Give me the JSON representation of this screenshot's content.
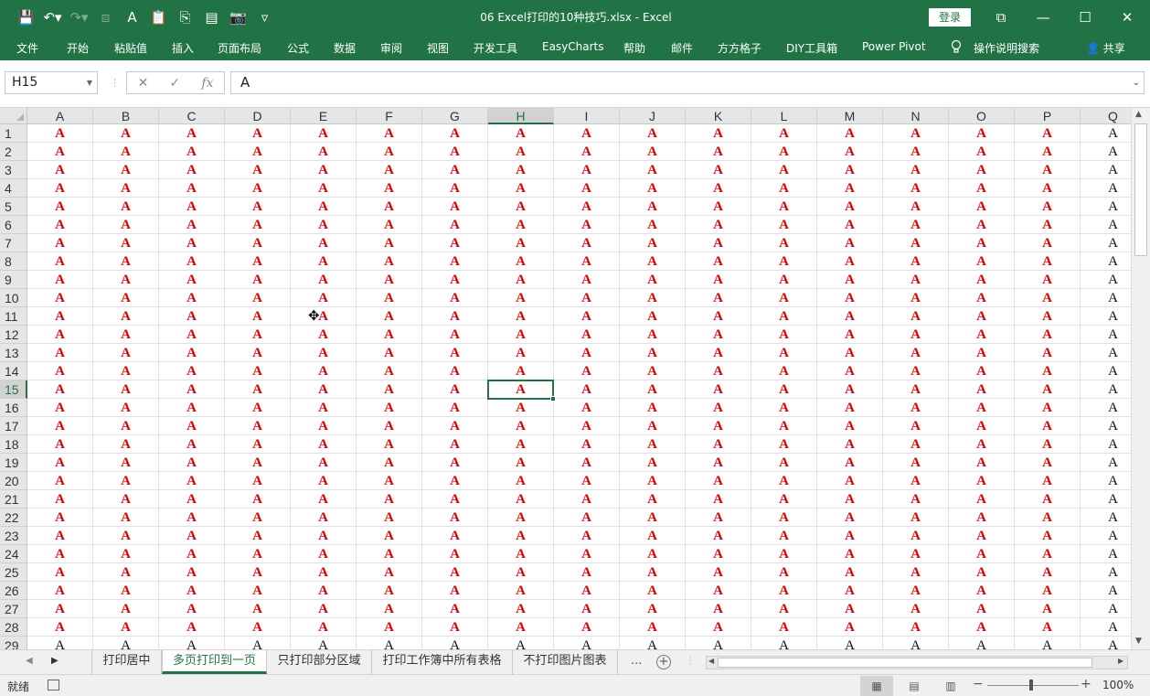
{
  "window": {
    "title": "06 Excel打印的10种技巧.xlsx  -  Excel",
    "login_label": "登录",
    "controls": {
      "restore_ribbon": "⧉",
      "minimize": "—",
      "maximize": "☐",
      "close": "✕"
    }
  },
  "qat": [
    {
      "name": "save-icon",
      "glyph": "💾"
    },
    {
      "name": "undo-icon",
      "glyph": "↶▾"
    },
    {
      "name": "redo-icon",
      "glyph": "↷▾"
    },
    {
      "name": "format-painter-icon",
      "glyph": "⧈"
    },
    {
      "name": "font-color-icon",
      "glyph": "A"
    },
    {
      "name": "paste-values-icon",
      "glyph": "📋"
    },
    {
      "name": "paste-icon",
      "glyph": "⎘"
    },
    {
      "name": "camera-icon",
      "glyph": "▤"
    },
    {
      "name": "screenshot-icon",
      "glyph": "📷"
    },
    {
      "name": "customize-qat-icon",
      "glyph": "▿"
    }
  ],
  "ribbon": {
    "tabs": [
      "文件",
      "开始",
      "粘贴值",
      "插入",
      "页面布局",
      "公式",
      "数据",
      "审阅",
      "视图",
      "开发工具",
      "EasyCharts",
      "帮助",
      "邮件",
      "方方格子",
      "DIY工具箱",
      "Power Pivot"
    ],
    "tell_me": "操作说明搜索",
    "share": "共享"
  },
  "formula_bar": {
    "name_box": "H15",
    "cancel_glyph": "✕",
    "enter_glyph": "✓",
    "fx_glyph": "fx",
    "value": "A"
  },
  "sheet": {
    "columns": [
      "A",
      "B",
      "C",
      "D",
      "E",
      "F",
      "G",
      "H",
      "I",
      "J",
      "K",
      "L",
      "M",
      "N",
      "O",
      "P",
      "Q"
    ],
    "rows": [
      "1",
      "2",
      "3",
      "4",
      "5",
      "6",
      "7",
      "8",
      "9",
      "10",
      "11",
      "12",
      "13",
      "14",
      "15",
      "16",
      "17",
      "18",
      "19",
      "20",
      "21",
      "22",
      "23",
      "24",
      "25",
      "26",
      "27",
      "28",
      "29"
    ],
    "cell_value": "A",
    "active_cell": "H15",
    "red_text": "#E00000",
    "black_text": "#111111"
  },
  "sheet_tabs": {
    "tabs": [
      "打印居中",
      "多页打印到一页",
      "只打印部分区域",
      "打印工作簿中所有表格",
      "不打印图片图表"
    ],
    "active_tab": "多页打印到一页",
    "more": "...",
    "add": "+"
  },
  "status_bar": {
    "ready": "就绪",
    "zoom": "100%"
  },
  "colors": {
    "brand": "#217346"
  }
}
